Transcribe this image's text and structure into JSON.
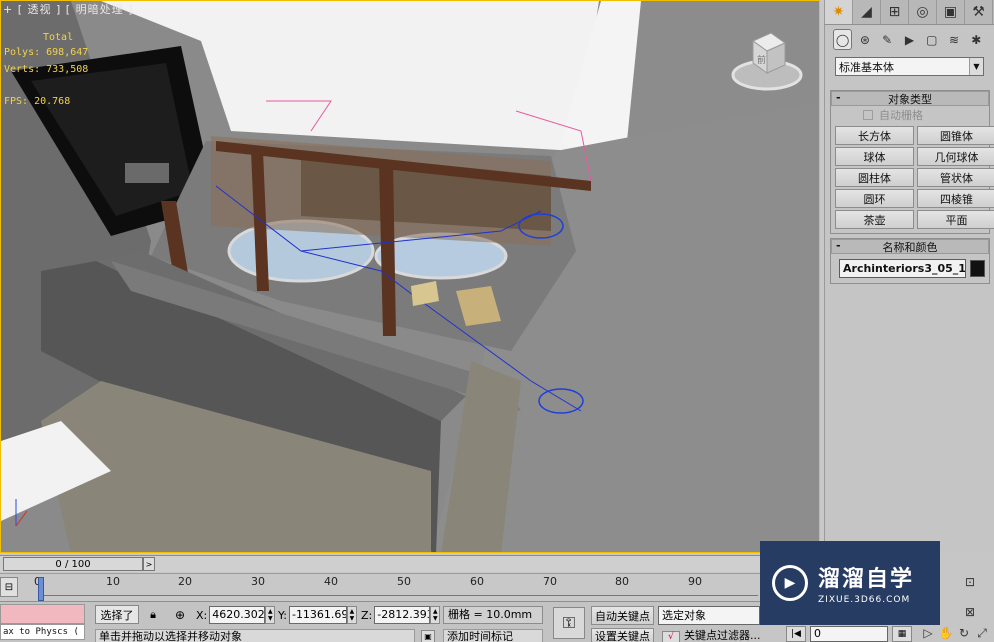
{
  "viewport": {
    "label": "+ [ 透视 ] [ 明暗处理 ]",
    "stats": {
      "total": "Total",
      "polys": "Polys: 698,647",
      "verts": "Verts: 733,508",
      "fps": "FPS:   20.768"
    },
    "viewcube_face": "前"
  },
  "command_panel": {
    "top_tabs": [
      "create-icon",
      "modify-icon",
      "hierarchy-icon",
      "motion-icon",
      "display-icon",
      "utilities-icon"
    ],
    "sub_tabs": [
      "geometry-icon",
      "shapes-icon",
      "lights-icon",
      "cameras-icon",
      "helpers-icon",
      "spacewarps-icon",
      "systems-icon"
    ],
    "category": "标准基本体",
    "object_type": {
      "title": "对象类型",
      "autogrid": "自动栅格",
      "buttons": [
        "长方体",
        "圆锥体",
        "球体",
        "几何球体",
        "圆柱体",
        "管状体",
        "圆环",
        "四棱锥",
        "茶壶",
        "平面"
      ]
    },
    "name_color": {
      "title": "名称和颜色",
      "name": "Archinteriors3_05_19",
      "color": "#111111"
    }
  },
  "time_slider": {
    "label": "0 / 100",
    "current_frame": 0,
    "total_frames": 100
  },
  "trackbar": {
    "ticks": [
      "0",
      "10",
      "20",
      "30",
      "40",
      "50",
      "60",
      "70",
      "80",
      "90"
    ]
  },
  "status": {
    "maxscript": "ax to Physcs (",
    "selection": "选择了",
    "x_label": "X:",
    "x": "4620.302m",
    "y_label": "Y:",
    "y": "-11361.69",
    "z_label": "Z:",
    "z": "-2812.393",
    "grid": "栅格 = 10.0mm",
    "prompt": "单击并拖动以选择并移动对象",
    "add_time_tag": "添加时间标记",
    "auto_key": "自动关键点",
    "set_key": "设置关键点",
    "selected_object": "选定对象",
    "key_filters": "关键点过滤器...",
    "frame": "0"
  },
  "watermark": {
    "name": "溜溜自学",
    "url": "ZIXUE.3D66.COM"
  }
}
